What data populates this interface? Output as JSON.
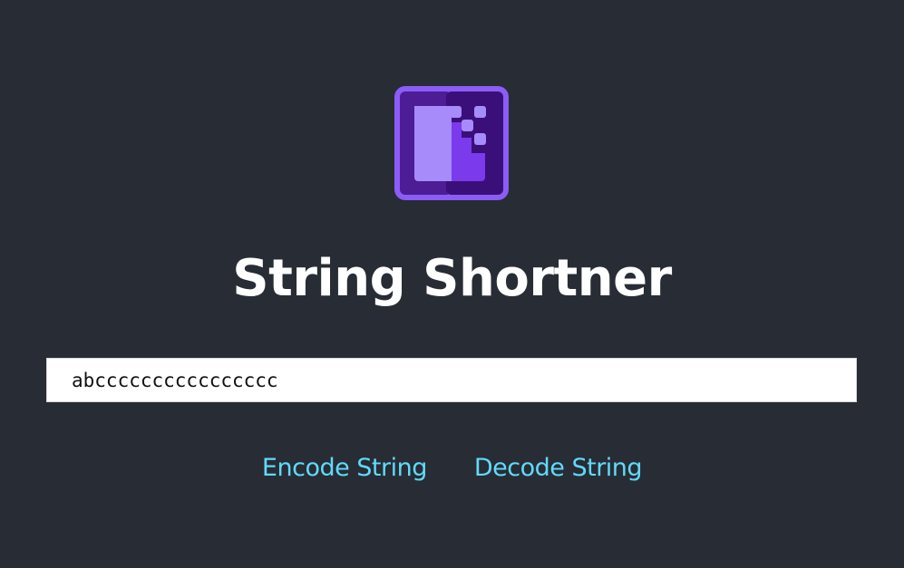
{
  "logo": {
    "icon": "string-shortener-logo-icon",
    "colors": {
      "frame": "#8b5cf6",
      "inner": "#5b21b6",
      "panel_light": "#a78bfa",
      "panel_dark": "#7c3aed"
    }
  },
  "title": "String Shortner",
  "input": {
    "value": "abcccccccccccccccc",
    "placeholder": ""
  },
  "actions": {
    "encode_label": "Encode String",
    "decode_label": "Decode String",
    "link_color": "#61dafb"
  },
  "theme": {
    "background": "#282c34"
  }
}
